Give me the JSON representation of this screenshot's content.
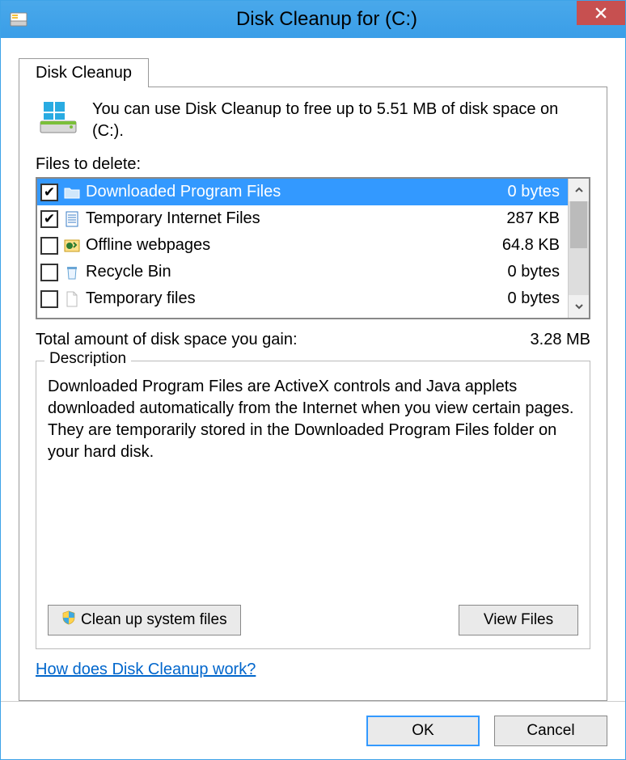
{
  "titlebar": {
    "title": "Disk Cleanup for  (C:)"
  },
  "tab": {
    "label": "Disk Cleanup"
  },
  "intro": {
    "text": "You can use Disk Cleanup to free up to 5.51 MB of disk space on  (C:)."
  },
  "files_label": "Files to delete:",
  "files": [
    {
      "checked": true,
      "icon": "folder",
      "name": "Downloaded Program Files",
      "size": "0 bytes",
      "selected": true
    },
    {
      "checked": true,
      "icon": "webdoc",
      "name": "Temporary Internet Files",
      "size": "287 KB",
      "selected": false
    },
    {
      "checked": false,
      "icon": "offline",
      "name": "Offline webpages",
      "size": "64.8 KB",
      "selected": false
    },
    {
      "checked": false,
      "icon": "recycle",
      "name": "Recycle Bin",
      "size": "0 bytes",
      "selected": false
    },
    {
      "checked": false,
      "icon": "file",
      "name": "Temporary files",
      "size": "0 bytes",
      "selected": false
    }
  ],
  "gain": {
    "label": "Total amount of disk space you gain:",
    "value": "3.28 MB"
  },
  "description": {
    "legend": "Description",
    "text": "Downloaded Program Files are ActiveX controls and Java applets downloaded automatically from the Internet when you view certain pages. They are temporarily stored in the Downloaded Program Files folder on your hard disk.",
    "cleanup_label": "Clean up system files",
    "view_label": "View Files"
  },
  "help_link": "How does Disk Cleanup work?",
  "footer": {
    "ok": "OK",
    "cancel": "Cancel"
  }
}
